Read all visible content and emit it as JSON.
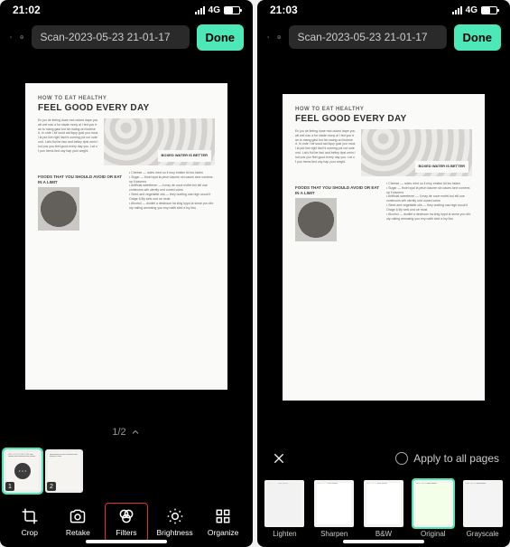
{
  "left": {
    "status": {
      "time": "21:02",
      "net": "4G"
    },
    "nav": {
      "title": "Scan-2023-05-23 21-01-17",
      "done": "Done"
    },
    "scan": {
      "kicker": "HOW TO EAT HEALTHY",
      "headline": "FEEL GOOD EVERY DAY",
      "box_label": "BOXED WATER IS BETTER",
      "sub": "FOODS THAT YOU SHOULD AVOID OR EAT IN A LIMIT",
      "bullets": [
        "Cheese",
        "Sugar",
        "Artificial sweetener",
        "Seed and vegetable oils",
        "Alcohol"
      ]
    },
    "pager": "1/2",
    "thumbs": [
      {
        "n": "1",
        "sel": true,
        "more": true
      },
      {
        "n": "2",
        "sel": false,
        "more": false
      }
    ],
    "tools": [
      {
        "key": "crop",
        "label": "Crop",
        "hl": false
      },
      {
        "key": "retake",
        "label": "Retake",
        "hl": false
      },
      {
        "key": "filters",
        "label": "Filters",
        "hl": true
      },
      {
        "key": "brightness",
        "label": "Brightness",
        "hl": false
      },
      {
        "key": "organize",
        "label": "Organize",
        "hl": false
      }
    ]
  },
  "right": {
    "status": {
      "time": "21:03",
      "net": "4G"
    },
    "nav": {
      "title": "Scan-2023-05-23 21-01-17",
      "done": "Done"
    },
    "apply_label": "Apply to all pages",
    "filters": [
      {
        "key": "lighten",
        "label": "Lighten",
        "sel": false
      },
      {
        "key": "sharpen",
        "label": "Sharpen",
        "sel": false
      },
      {
        "key": "bw",
        "label": "B&W",
        "sel": false
      },
      {
        "key": "original",
        "label": "Original",
        "sel": true
      },
      {
        "key": "grayscale",
        "label": "Grayscale",
        "sel": false
      }
    ]
  }
}
